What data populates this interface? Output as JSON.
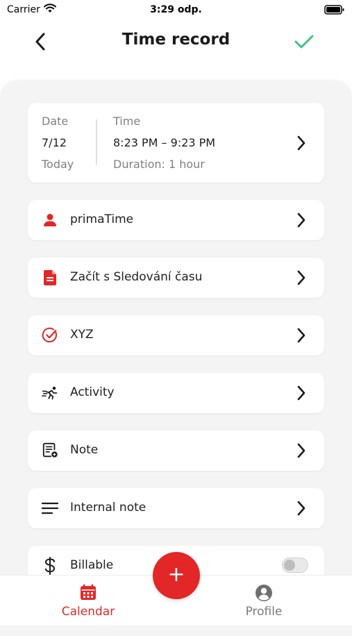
{
  "status": {
    "carrier": "Carrier",
    "time": "3:29 odp."
  },
  "header": {
    "title": "Time record"
  },
  "datetime": {
    "date_label": "Date",
    "date_value": "7/12",
    "date_relative": "Today",
    "time_label": "Time",
    "time_value": "8:23 PM – 9:23 PM",
    "duration": "Duration: 1 hour"
  },
  "rows": [
    {
      "label": "primaTime",
      "icon": "person-icon"
    },
    {
      "label": "Začít s Sledování času",
      "icon": "document-icon"
    },
    {
      "label": "XYZ",
      "icon": "check-circle-icon"
    },
    {
      "label": "Activity",
      "icon": "running-icon"
    },
    {
      "label": "Note",
      "icon": "note-icon"
    },
    {
      "label": "Internal note",
      "icon": "lines-icon"
    },
    {
      "label": "Billable",
      "icon": "dollar-icon"
    }
  ],
  "billable_on": false,
  "tabs": {
    "calendar": "Calendar",
    "profile": "Profile"
  },
  "fab": {
    "label": "+"
  },
  "colors": {
    "accent": "#e32727",
    "confirm": "#3cc47c",
    "text": "#1e1e1e",
    "muted": "#808080"
  }
}
